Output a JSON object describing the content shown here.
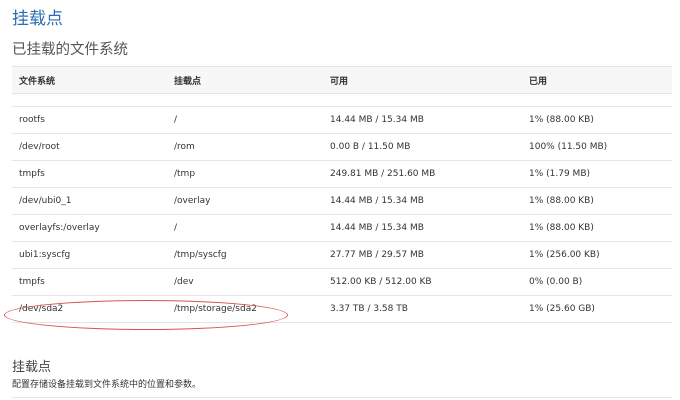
{
  "page": {
    "title": "挂载点"
  },
  "mounted_fs": {
    "title": "已挂载的文件系统",
    "columns": [
      "文件系统",
      "挂载点",
      "可用",
      "已用"
    ],
    "rows": [
      {
        "fs": "rootfs",
        "mount": "/",
        "available": "14.44 MB / 15.34 MB",
        "used": "1% (88.00 KB)"
      },
      {
        "fs": "/dev/root",
        "mount": "/rom",
        "available": "0.00 B / 11.50 MB",
        "used": "100% (11.50 MB)"
      },
      {
        "fs": "tmpfs",
        "mount": "/tmp",
        "available": "249.81 MB / 251.60 MB",
        "used": "1% (1.79 MB)"
      },
      {
        "fs": "/dev/ubi0_1",
        "mount": "/overlay",
        "available": "14.44 MB / 15.34 MB",
        "used": "1% (88.00 KB)"
      },
      {
        "fs": "overlayfs:/overlay",
        "mount": "/",
        "available": "14.44 MB / 15.34 MB",
        "used": "1% (88.00 KB)"
      },
      {
        "fs": "ubi1:syscfg",
        "mount": "/tmp/syscfg",
        "available": "27.77 MB / 29.57 MB",
        "used": "1% (256.00 KB)"
      },
      {
        "fs": "tmpfs",
        "mount": "/dev",
        "available": "512.00 KB / 512.00 KB",
        "used": "0% (0.00 B)"
      },
      {
        "fs": "/dev/sda2",
        "mount": "/tmp/storage/sda2",
        "available": "3.37 TB / 3.58 TB",
        "used": "1% (25.60 GB)"
      }
    ]
  },
  "mount_points": {
    "title": "挂载点",
    "description": "配置存储设备挂载到文件系统中的位置和参数。"
  },
  "colors": {
    "title": "#2a6db0",
    "highlight": "#d9534f"
  }
}
